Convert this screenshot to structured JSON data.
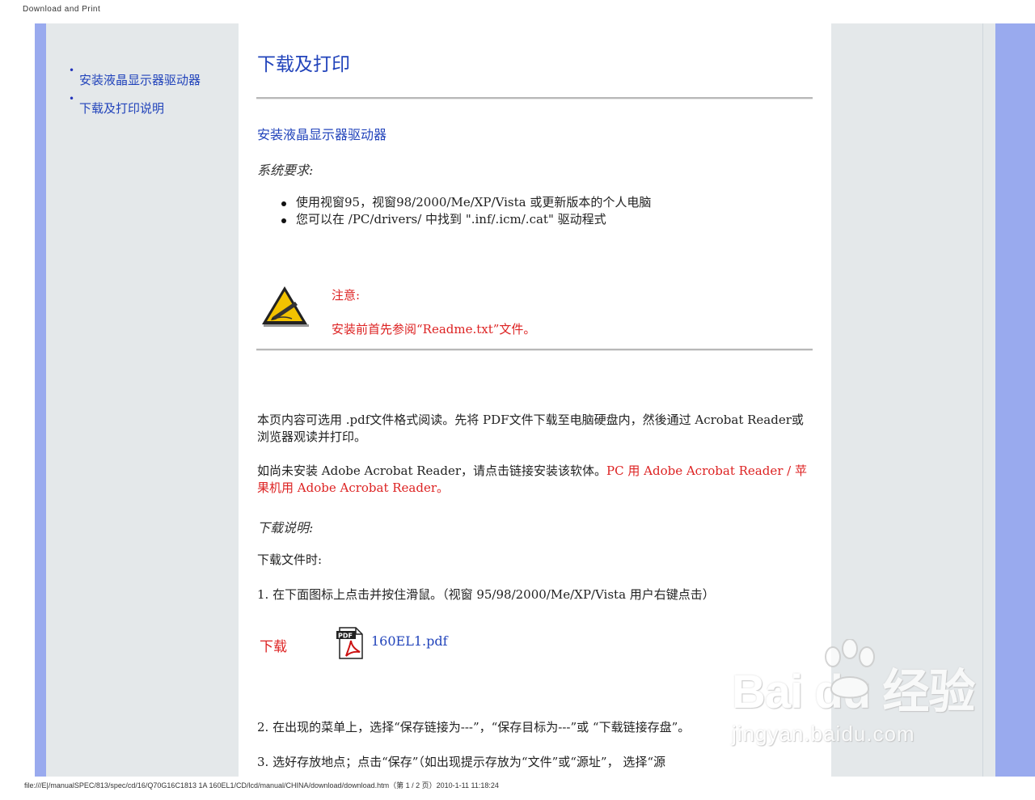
{
  "print_header": "Download and Print",
  "print_footer": "file:///E|/manualSPEC/813/spec/cd/16/Q70G16C1813 1A 160EL1/CD/lcd/manual/CHINA/download/download.htm（第 1 / 2 页）2010-1-11 11:18:24",
  "nav": {
    "items": [
      {
        "label": "安装液晶显示器驱动器"
      },
      {
        "label": "下载及打印说明"
      }
    ]
  },
  "main": {
    "title": "下载及打印",
    "section_link": "安装液晶显示器驱动器",
    "system_requirements": "系统要求:",
    "requirements": [
      "使用视窗95，视窗98/2000/Me/XP/Vista 或更新版本的个人电脑",
      "您可以在 /PC/drivers/ 中找到 \".inf/.icm/.cat\" 驱动程式"
    ],
    "note": {
      "label": "注意:",
      "text": "安装前首先参阅“Readme.txt”文件。"
    },
    "pdf_intro": "本页内容可选用 .pdf文件格式阅读。先将 PDF文件下载至电脑硬盘内，然後通过 Acrobat Reader或浏览器观读并打印。",
    "adobe_prefix": "如尚未安装 Adobe   Acrobat Reader，请点击链接安装该软体。",
    "adobe_link_pc": "PC 用 Adobe   Acrobat Reader",
    "adobe_separator": " / ",
    "adobe_link_mac": "苹果机用 Adobe   Acrobat Reader。",
    "download_instructions": "下载说明:",
    "download_when": "下载文件时:",
    "step1": "1. 在下面图标上点击并按住滑鼠。（视窗 95/98/2000/Me/XP/Vista 用户右键点击）",
    "download_label": "下载",
    "pdf_file": "160EL1.pdf",
    "step2": "2. 在出现的菜单上，选择“保存链接为---”，“保存目标为---”或 “下载链接存盘”。",
    "step3": "3. 选好存放地点；点击“保存”（如出现提示存放为“文件”或“源址”， 选择“源"
  },
  "watermark": {
    "brand": "Bai du 经验",
    "url": "jingyan.baidu.com"
  },
  "colors": {
    "link_blue": "#2244bb",
    "note_red": "#dd2222",
    "side_strip": "#99aaee",
    "side_panel": "#e4e8ea"
  },
  "icons": [
    "note-pen-warning-icon",
    "pdf-file-icon",
    "baidu-paw-icon"
  ]
}
